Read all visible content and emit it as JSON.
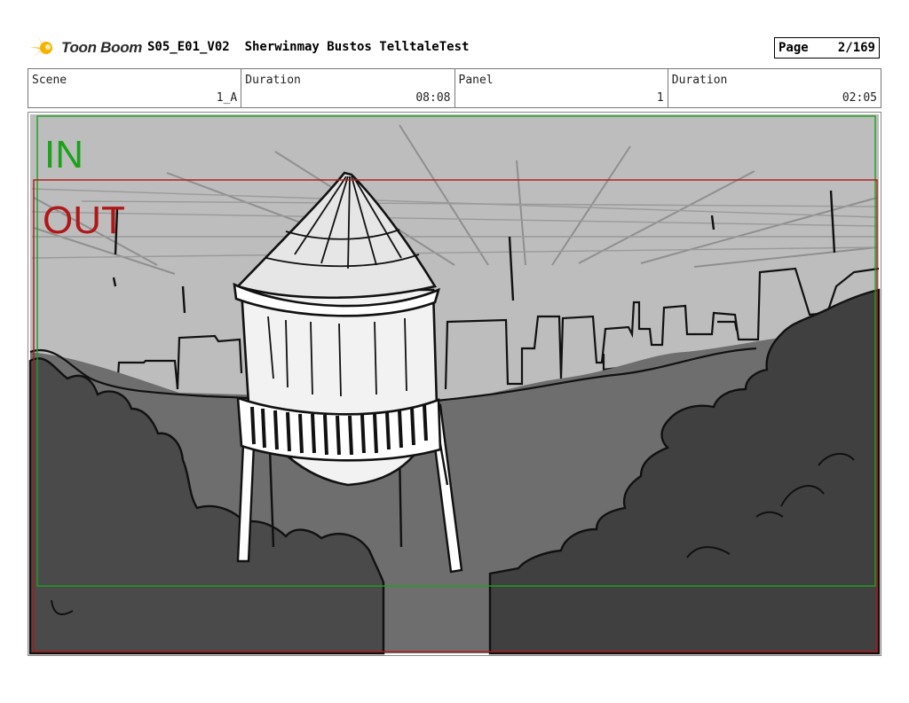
{
  "header": {
    "logo_text": "Toon Boom",
    "project_title": "S05_E01_V02  Sherwinmay Bustos TelltaleTest",
    "page_label": "Page",
    "page_number": "2/169"
  },
  "info": {
    "scene_label": "Scene",
    "scene_value": "1_A",
    "duration_label": "Duration",
    "duration_value": "08:08",
    "panel_label": "Panel",
    "panel_value": "1",
    "panel_duration_label": "Duration",
    "panel_duration_value": "02:05"
  },
  "panel": {
    "in_label": "IN",
    "out_label": "OUT",
    "in_color": "#1aa31a",
    "out_color": "#b01818"
  }
}
